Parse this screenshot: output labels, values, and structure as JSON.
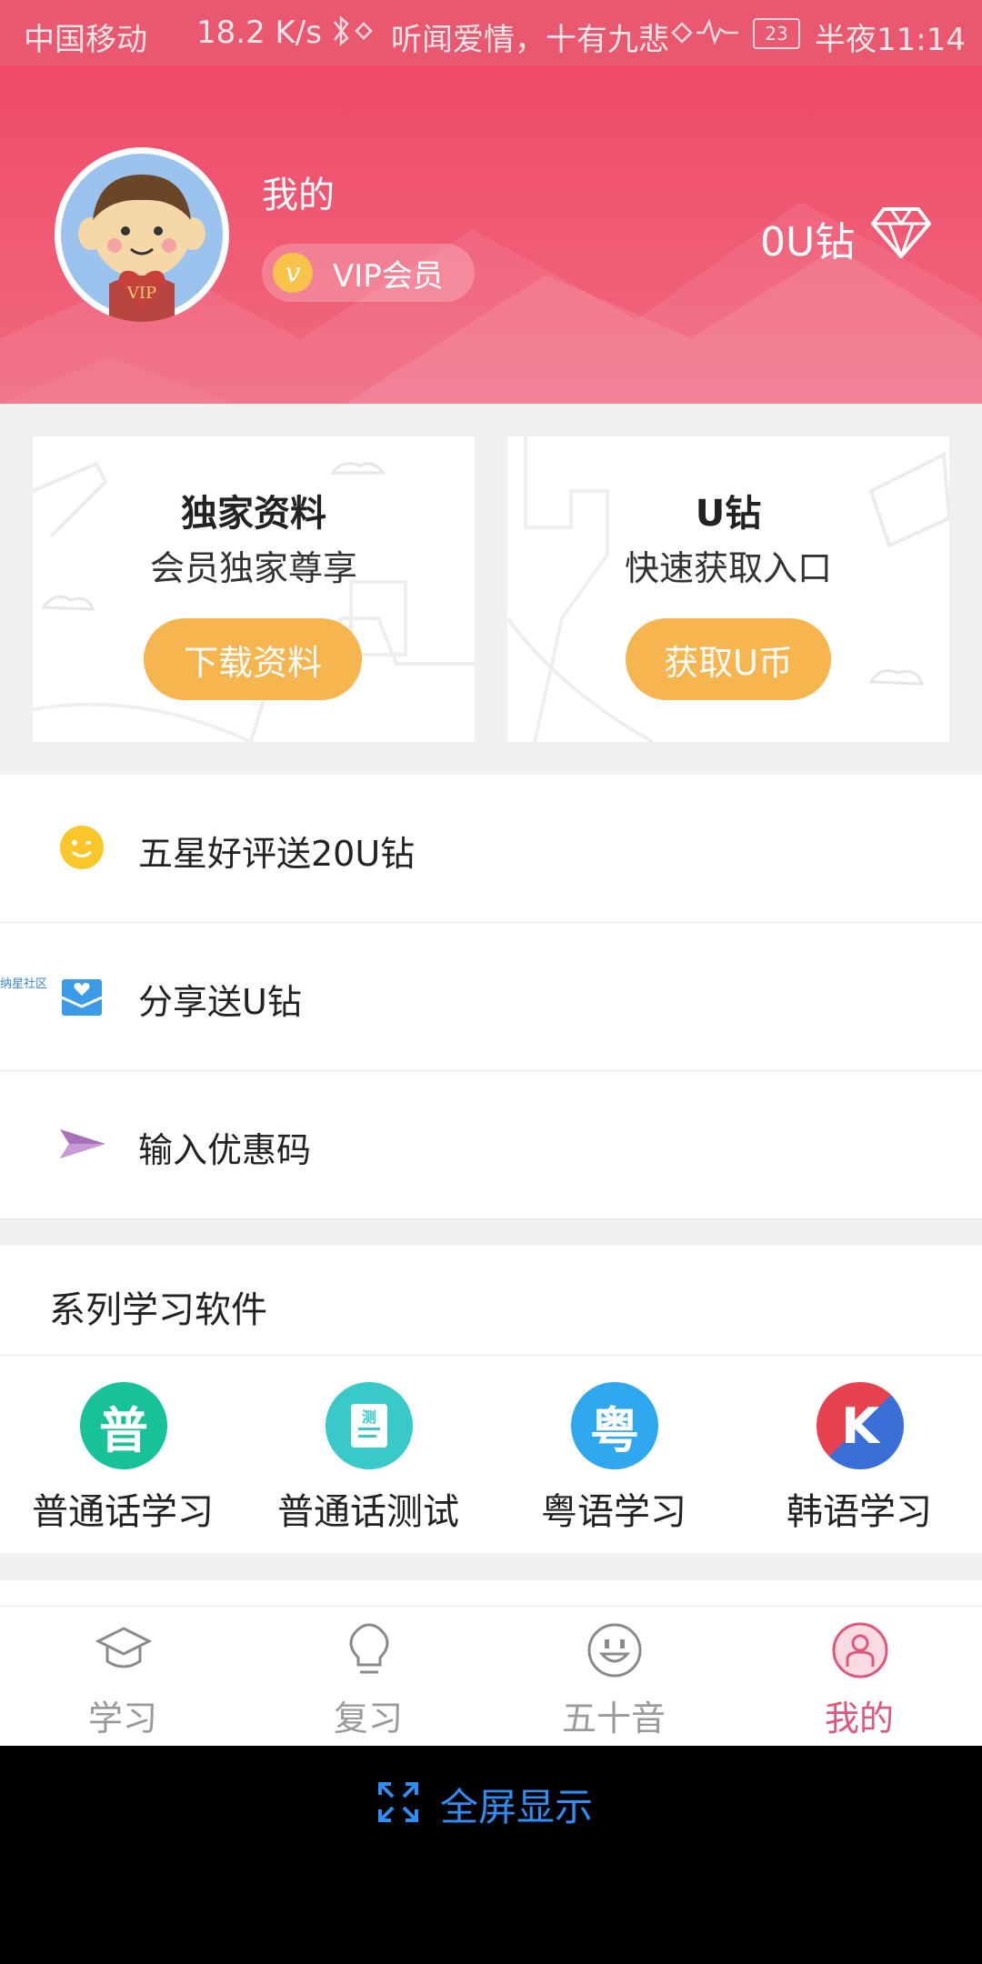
{
  "status_bar": {
    "carrier": "中国移动",
    "speed": "18.2 K/s",
    "song": "听闻爱情，十有九悲",
    "battery": "23",
    "time": "半夜11:14"
  },
  "header": {
    "title": "我的",
    "vip_label": "VIP会员",
    "vip_icon_letter": "v",
    "avatar_badge": "VIP",
    "coins": "0U钻",
    "bg_color": "#ef4a68"
  },
  "cards": [
    {
      "title": "独家资料",
      "subtitle": "会员独家尊享",
      "button": "下载资料"
    },
    {
      "title": "U钻",
      "subtitle": "快速获取入口",
      "button": "获取U币"
    }
  ],
  "list": {
    "items": [
      {
        "label": "五星好评送20U钻",
        "icon": "smile-icon"
      },
      {
        "label": "分享送U钻",
        "icon": "share-envelope-icon",
        "tag": "纳星社区"
      },
      {
        "label": "输入优惠码",
        "icon": "paper-plane-icon"
      }
    ]
  },
  "series": {
    "title": "系列学习软件",
    "apps": [
      {
        "label": "普通话学习",
        "icon_text": "普",
        "color": "#17c29a"
      },
      {
        "label": "普通话测试",
        "icon_text": "测",
        "color": "#38c9c8"
      },
      {
        "label": "粤语学习",
        "icon_text": "粤",
        "color": "#2fa8ef"
      },
      {
        "label": "韩语学习",
        "icon_text": "K",
        "color": "#e8414f"
      }
    ]
  },
  "tabbar": {
    "tabs": [
      {
        "label": "学习",
        "icon": "graduation-cap-icon"
      },
      {
        "label": "复习",
        "icon": "lightbulb-icon"
      },
      {
        "label": "五十音",
        "icon": "smiley-face-icon"
      },
      {
        "label": "我的",
        "icon": "user-icon",
        "active": true
      }
    ],
    "active_color": "#e0577a"
  },
  "fullscreen": {
    "label": "全屏显示",
    "color": "#2f8df5"
  }
}
